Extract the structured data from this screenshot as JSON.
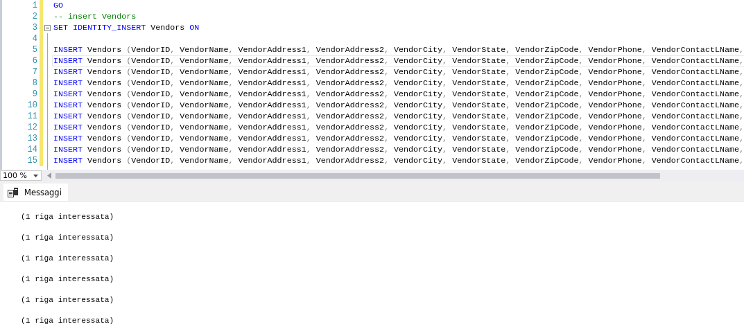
{
  "editor": {
    "lines": [
      {
        "number": "1",
        "current": false,
        "collapsible": false,
        "tokens": [
          {
            "kind": "keyword",
            "text": "GO"
          }
        ]
      },
      {
        "number": "2",
        "current": false,
        "collapsible": false,
        "tokens": [
          {
            "kind": "comment",
            "text": "-- insert Vendors"
          }
        ]
      },
      {
        "number": "3",
        "current": false,
        "collapsible": true,
        "tokens": [
          {
            "kind": "keyword",
            "text": "SET IDENTITY_INSERT"
          },
          {
            "kind": "name",
            "text": " Vendors "
          },
          {
            "kind": "keyword",
            "text": "ON"
          }
        ]
      },
      {
        "number": "4",
        "current": false,
        "collapsible": false
      },
      {
        "number": "5",
        "current": false,
        "collapsible": false,
        "tokens": [
          {
            "kind": "keyword",
            "text": "INSERT"
          },
          {
            "kind": "name",
            "text": " Vendors "
          },
          {
            "kind": "punctuation",
            "text": "("
          },
          {
            "kind": "name",
            "text": "VendorID"
          },
          {
            "kind": "punctuation",
            "text": ", "
          },
          {
            "kind": "name",
            "text": "VendorName"
          },
          {
            "kind": "punctuation",
            "text": ", "
          },
          {
            "kind": "name",
            "text": "VendorAddress1"
          },
          {
            "kind": "punctuation",
            "text": ", "
          },
          {
            "kind": "name",
            "text": "VendorAddress2"
          },
          {
            "kind": "punctuation",
            "text": ", "
          },
          {
            "kind": "name",
            "text": "VendorCity"
          },
          {
            "kind": "punctuation",
            "text": ", "
          },
          {
            "kind": "name",
            "text": "VendorState"
          },
          {
            "kind": "punctuation",
            "text": ", "
          },
          {
            "kind": "name",
            "text": "VendorZipCode"
          },
          {
            "kind": "punctuation",
            "text": ", "
          },
          {
            "kind": "name",
            "text": "VendorPhone"
          },
          {
            "kind": "punctuation",
            "text": ", "
          },
          {
            "kind": "name",
            "text": "VendorContactLName"
          },
          {
            "kind": "punctuation",
            "text": ","
          }
        ]
      },
      {
        "number": "6",
        "current": true,
        "collapsible": false,
        "tokens": [
          {
            "kind": "keyword",
            "text": "INSERT"
          },
          {
            "kind": "name",
            "text": " Vendors "
          },
          {
            "kind": "punctuation",
            "text": "("
          },
          {
            "kind": "name",
            "text": "VendorID"
          },
          {
            "kind": "punctuation",
            "text": ", "
          },
          {
            "kind": "name",
            "text": "VendorName"
          },
          {
            "kind": "punctuation",
            "text": ", "
          },
          {
            "kind": "name",
            "text": "VendorAddress1"
          },
          {
            "kind": "punctuation",
            "text": ", "
          },
          {
            "kind": "name",
            "text": "VendorAddress2"
          },
          {
            "kind": "punctuation",
            "text": ", "
          },
          {
            "kind": "name",
            "text": "VendorCity"
          },
          {
            "kind": "punctuation",
            "text": ", "
          },
          {
            "kind": "name",
            "text": "VendorState"
          },
          {
            "kind": "punctuation",
            "text": ", "
          },
          {
            "kind": "name",
            "text": "VendorZipCode"
          },
          {
            "kind": "punctuation",
            "text": ", "
          },
          {
            "kind": "name",
            "text": "VendorPhone"
          },
          {
            "kind": "punctuation",
            "text": ", "
          },
          {
            "kind": "name",
            "text": "VendorContactLName"
          },
          {
            "kind": "punctuation",
            "text": ","
          }
        ]
      },
      {
        "number": "7",
        "current": false,
        "collapsible": false,
        "tokens": [
          {
            "kind": "keyword",
            "text": "INSERT"
          },
          {
            "kind": "name",
            "text": " Vendors "
          },
          {
            "kind": "punctuation",
            "text": "("
          },
          {
            "kind": "name",
            "text": "VendorID"
          },
          {
            "kind": "punctuation",
            "text": ", "
          },
          {
            "kind": "name",
            "text": "VendorName"
          },
          {
            "kind": "punctuation",
            "text": ", "
          },
          {
            "kind": "name",
            "text": "VendorAddress1"
          },
          {
            "kind": "punctuation",
            "text": ", "
          },
          {
            "kind": "name",
            "text": "VendorAddress2"
          },
          {
            "kind": "punctuation",
            "text": ", "
          },
          {
            "kind": "name",
            "text": "VendorCity"
          },
          {
            "kind": "punctuation",
            "text": ", "
          },
          {
            "kind": "name",
            "text": "VendorState"
          },
          {
            "kind": "punctuation",
            "text": ", "
          },
          {
            "kind": "name",
            "text": "VendorZipCode"
          },
          {
            "kind": "punctuation",
            "text": ", "
          },
          {
            "kind": "name",
            "text": "VendorPhone"
          },
          {
            "kind": "punctuation",
            "text": ", "
          },
          {
            "kind": "name",
            "text": "VendorContactLName"
          },
          {
            "kind": "punctuation",
            "text": ","
          }
        ]
      },
      {
        "number": "8",
        "current": false,
        "collapsible": false,
        "tokens": [
          {
            "kind": "keyword",
            "text": "INSERT"
          },
          {
            "kind": "name",
            "text": " Vendors "
          },
          {
            "kind": "punctuation",
            "text": "("
          },
          {
            "kind": "name",
            "text": "VendorID"
          },
          {
            "kind": "punctuation",
            "text": ", "
          },
          {
            "kind": "name",
            "text": "VendorName"
          },
          {
            "kind": "punctuation",
            "text": ", "
          },
          {
            "kind": "name",
            "text": "VendorAddress1"
          },
          {
            "kind": "punctuation",
            "text": ", "
          },
          {
            "kind": "name",
            "text": "VendorAddress2"
          },
          {
            "kind": "punctuation",
            "text": ", "
          },
          {
            "kind": "name",
            "text": "VendorCity"
          },
          {
            "kind": "punctuation",
            "text": ", "
          },
          {
            "kind": "name",
            "text": "VendorState"
          },
          {
            "kind": "punctuation",
            "text": ", "
          },
          {
            "kind": "name",
            "text": "VendorZipCode"
          },
          {
            "kind": "punctuation",
            "text": ", "
          },
          {
            "kind": "name",
            "text": "VendorPhone"
          },
          {
            "kind": "punctuation",
            "text": ", "
          },
          {
            "kind": "name",
            "text": "VendorContactLName"
          },
          {
            "kind": "punctuation",
            "text": ","
          }
        ]
      },
      {
        "number": "9",
        "current": false,
        "collapsible": false,
        "tokens": [
          {
            "kind": "keyword",
            "text": "INSERT"
          },
          {
            "kind": "name",
            "text": " Vendors "
          },
          {
            "kind": "punctuation",
            "text": "("
          },
          {
            "kind": "name",
            "text": "VendorID"
          },
          {
            "kind": "punctuation",
            "text": ", "
          },
          {
            "kind": "name",
            "text": "VendorName"
          },
          {
            "kind": "punctuation",
            "text": ", "
          },
          {
            "kind": "name",
            "text": "VendorAddress1"
          },
          {
            "kind": "punctuation",
            "text": ", "
          },
          {
            "kind": "name",
            "text": "VendorAddress2"
          },
          {
            "kind": "punctuation",
            "text": ", "
          },
          {
            "kind": "name",
            "text": "VendorCity"
          },
          {
            "kind": "punctuation",
            "text": ", "
          },
          {
            "kind": "name",
            "text": "VendorState"
          },
          {
            "kind": "punctuation",
            "text": ", "
          },
          {
            "kind": "name",
            "text": "VendorZipCode"
          },
          {
            "kind": "punctuation",
            "text": ", "
          },
          {
            "kind": "name",
            "text": "VendorPhone"
          },
          {
            "kind": "punctuation",
            "text": ", "
          },
          {
            "kind": "name",
            "text": "VendorContactLName"
          },
          {
            "kind": "punctuation",
            "text": ","
          }
        ]
      },
      {
        "number": "10",
        "current": false,
        "collapsible": false,
        "tokens": [
          {
            "kind": "keyword",
            "text": "INSERT"
          },
          {
            "kind": "name",
            "text": " Vendors "
          },
          {
            "kind": "punctuation",
            "text": "("
          },
          {
            "kind": "name",
            "text": "VendorID"
          },
          {
            "kind": "punctuation",
            "text": ", "
          },
          {
            "kind": "name",
            "text": "VendorName"
          },
          {
            "kind": "punctuation",
            "text": ", "
          },
          {
            "kind": "name",
            "text": "VendorAddress1"
          },
          {
            "kind": "punctuation",
            "text": ", "
          },
          {
            "kind": "name",
            "text": "VendorAddress2"
          },
          {
            "kind": "punctuation",
            "text": ", "
          },
          {
            "kind": "name",
            "text": "VendorCity"
          },
          {
            "kind": "punctuation",
            "text": ", "
          },
          {
            "kind": "name",
            "text": "VendorState"
          },
          {
            "kind": "punctuation",
            "text": ", "
          },
          {
            "kind": "name",
            "text": "VendorZipCode"
          },
          {
            "kind": "punctuation",
            "text": ", "
          },
          {
            "kind": "name",
            "text": "VendorPhone"
          },
          {
            "kind": "punctuation",
            "text": ", "
          },
          {
            "kind": "name",
            "text": "VendorContactLName"
          },
          {
            "kind": "punctuation",
            "text": ","
          }
        ]
      },
      {
        "number": "11",
        "current": false,
        "collapsible": false,
        "tokens": [
          {
            "kind": "keyword",
            "text": "INSERT"
          },
          {
            "kind": "name",
            "text": " Vendors "
          },
          {
            "kind": "punctuation",
            "text": "("
          },
          {
            "kind": "name",
            "text": "VendorID"
          },
          {
            "kind": "punctuation",
            "text": ", "
          },
          {
            "kind": "name",
            "text": "VendorName"
          },
          {
            "kind": "punctuation",
            "text": ", "
          },
          {
            "kind": "name",
            "text": "VendorAddress1"
          },
          {
            "kind": "punctuation",
            "text": ", "
          },
          {
            "kind": "name",
            "text": "VendorAddress2"
          },
          {
            "kind": "punctuation",
            "text": ", "
          },
          {
            "kind": "name",
            "text": "VendorCity"
          },
          {
            "kind": "punctuation",
            "text": ", "
          },
          {
            "kind": "name",
            "text": "VendorState"
          },
          {
            "kind": "punctuation",
            "text": ", "
          },
          {
            "kind": "name",
            "text": "VendorZipCode"
          },
          {
            "kind": "punctuation",
            "text": ", "
          },
          {
            "kind": "name",
            "text": "VendorPhone"
          },
          {
            "kind": "punctuation",
            "text": ", "
          },
          {
            "kind": "name",
            "text": "VendorContactLName"
          },
          {
            "kind": "punctuation",
            "text": ","
          }
        ]
      },
      {
        "number": "12",
        "current": false,
        "collapsible": false,
        "tokens": [
          {
            "kind": "keyword",
            "text": "INSERT"
          },
          {
            "kind": "name",
            "text": " Vendors "
          },
          {
            "kind": "punctuation",
            "text": "("
          },
          {
            "kind": "name",
            "text": "VendorID"
          },
          {
            "kind": "punctuation",
            "text": ", "
          },
          {
            "kind": "name",
            "text": "VendorName"
          },
          {
            "kind": "punctuation",
            "text": ", "
          },
          {
            "kind": "name",
            "text": "VendorAddress1"
          },
          {
            "kind": "punctuation",
            "text": ", "
          },
          {
            "kind": "name",
            "text": "VendorAddress2"
          },
          {
            "kind": "punctuation",
            "text": ", "
          },
          {
            "kind": "name",
            "text": "VendorCity"
          },
          {
            "kind": "punctuation",
            "text": ", "
          },
          {
            "kind": "name",
            "text": "VendorState"
          },
          {
            "kind": "punctuation",
            "text": ", "
          },
          {
            "kind": "name",
            "text": "VendorZipCode"
          },
          {
            "kind": "punctuation",
            "text": ", "
          },
          {
            "kind": "name",
            "text": "VendorPhone"
          },
          {
            "kind": "punctuation",
            "text": ", "
          },
          {
            "kind": "name",
            "text": "VendorContactLName"
          },
          {
            "kind": "punctuation",
            "text": ","
          }
        ]
      },
      {
        "number": "13",
        "current": false,
        "collapsible": false,
        "tokens": [
          {
            "kind": "keyword",
            "text": "INSERT"
          },
          {
            "kind": "name",
            "text": " Vendors "
          },
          {
            "kind": "punctuation",
            "text": "("
          },
          {
            "kind": "name",
            "text": "VendorID"
          },
          {
            "kind": "punctuation",
            "text": ", "
          },
          {
            "kind": "name",
            "text": "VendorName"
          },
          {
            "kind": "punctuation",
            "text": ", "
          },
          {
            "kind": "name",
            "text": "VendorAddress1"
          },
          {
            "kind": "punctuation",
            "text": ", "
          },
          {
            "kind": "name",
            "text": "VendorAddress2"
          },
          {
            "kind": "punctuation",
            "text": ", "
          },
          {
            "kind": "name",
            "text": "VendorCity"
          },
          {
            "kind": "punctuation",
            "text": ", "
          },
          {
            "kind": "name",
            "text": "VendorState"
          },
          {
            "kind": "punctuation",
            "text": ", "
          },
          {
            "kind": "name",
            "text": "VendorZipCode"
          },
          {
            "kind": "punctuation",
            "text": ", "
          },
          {
            "kind": "name",
            "text": "VendorPhone"
          },
          {
            "kind": "punctuation",
            "text": ", "
          },
          {
            "kind": "name",
            "text": "VendorContactLName"
          },
          {
            "kind": "punctuation",
            "text": ","
          }
        ]
      },
      {
        "number": "14",
        "current": false,
        "collapsible": false,
        "tokens": [
          {
            "kind": "keyword",
            "text": "INSERT"
          },
          {
            "kind": "name",
            "text": " Vendors "
          },
          {
            "kind": "punctuation",
            "text": "("
          },
          {
            "kind": "name",
            "text": "VendorID"
          },
          {
            "kind": "punctuation",
            "text": ", "
          },
          {
            "kind": "name",
            "text": "VendorName"
          },
          {
            "kind": "punctuation",
            "text": ", "
          },
          {
            "kind": "name",
            "text": "VendorAddress1"
          },
          {
            "kind": "punctuation",
            "text": ", "
          },
          {
            "kind": "name",
            "text": "VendorAddress2"
          },
          {
            "kind": "punctuation",
            "text": ", "
          },
          {
            "kind": "name",
            "text": "VendorCity"
          },
          {
            "kind": "punctuation",
            "text": ", "
          },
          {
            "kind": "name",
            "text": "VendorState"
          },
          {
            "kind": "punctuation",
            "text": ", "
          },
          {
            "kind": "name",
            "text": "VendorZipCode"
          },
          {
            "kind": "punctuation",
            "text": ", "
          },
          {
            "kind": "name",
            "text": "VendorPhone"
          },
          {
            "kind": "punctuation",
            "text": ", "
          },
          {
            "kind": "name",
            "text": "VendorContactLName"
          },
          {
            "kind": "punctuation",
            "text": ","
          }
        ]
      },
      {
        "number": "15",
        "current": false,
        "collapsible": false,
        "tokens": [
          {
            "kind": "keyword",
            "text": "INSERT"
          },
          {
            "kind": "name",
            "text": " Vendors "
          },
          {
            "kind": "punctuation",
            "text": "("
          },
          {
            "kind": "name",
            "text": "VendorID"
          },
          {
            "kind": "punctuation",
            "text": ", "
          },
          {
            "kind": "name",
            "text": "VendorName"
          },
          {
            "kind": "punctuation",
            "text": ", "
          },
          {
            "kind": "name",
            "text": "VendorAddress1"
          },
          {
            "kind": "punctuation",
            "text": ", "
          },
          {
            "kind": "name",
            "text": "VendorAddress2"
          },
          {
            "kind": "punctuation",
            "text": ", "
          },
          {
            "kind": "name",
            "text": "VendorCity"
          },
          {
            "kind": "punctuation",
            "text": ", "
          },
          {
            "kind": "name",
            "text": "VendorState"
          },
          {
            "kind": "punctuation",
            "text": ", "
          },
          {
            "kind": "name",
            "text": "VendorZipCode"
          },
          {
            "kind": "punctuation",
            "text": ", "
          },
          {
            "kind": "name",
            "text": "VendorPhone"
          },
          {
            "kind": "punctuation",
            "text": ", "
          },
          {
            "kind": "name",
            "text": "VendorContactLName"
          },
          {
            "kind": "punctuation",
            "text": ","
          }
        ]
      }
    ]
  },
  "zoom": {
    "value": "100 %"
  },
  "results": {
    "tabs": [
      {
        "label": "Messaggi",
        "selected": true
      }
    ],
    "messages": [
      "(1 riga interessata)",
      "(1 riga interessata)",
      "(1 riga interessata)",
      "(1 riga interessata)",
      "(1 riga interessata)",
      "(1 riga interessata)"
    ]
  }
}
